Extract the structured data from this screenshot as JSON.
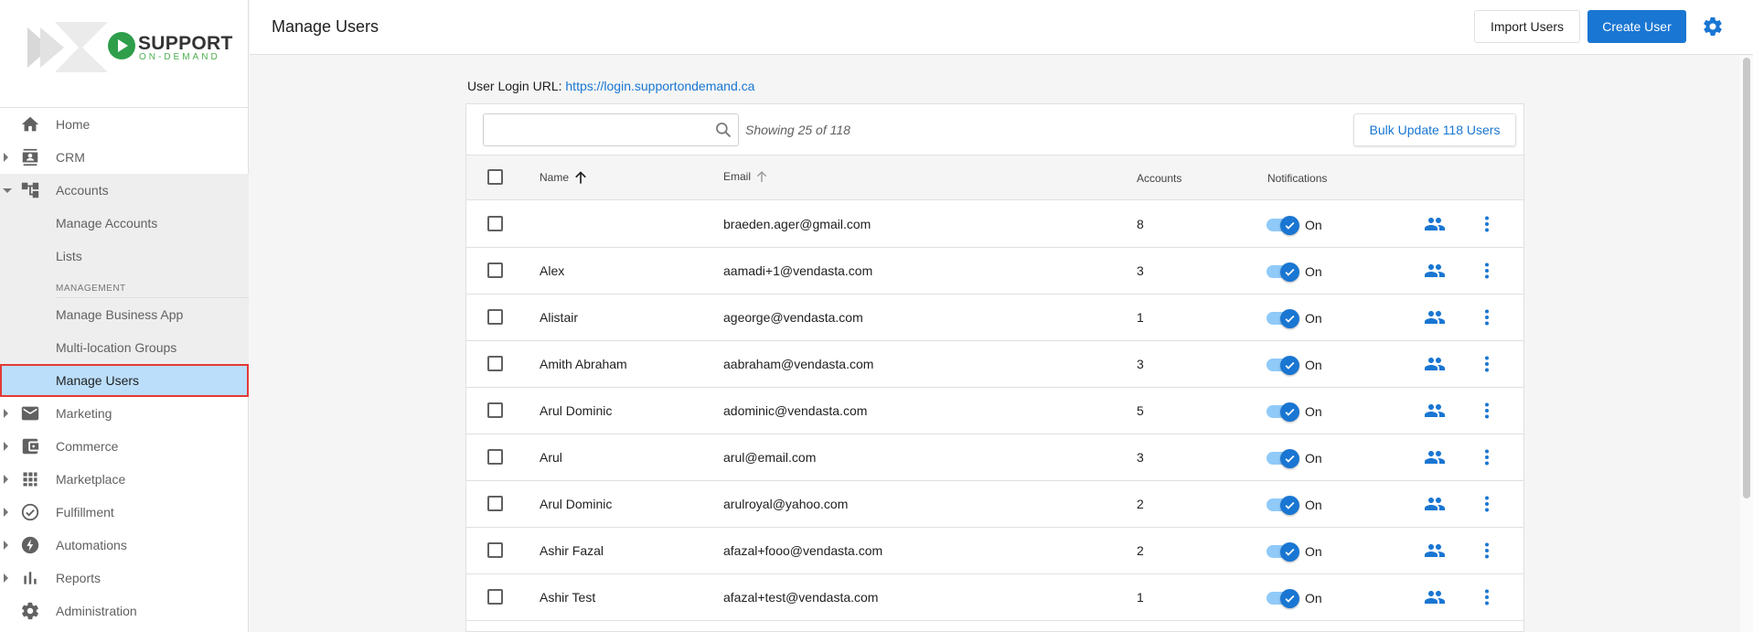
{
  "brand": {
    "line1": "SUPPORT",
    "line2": "ON-DEMAND"
  },
  "header": {
    "title": "Manage Users",
    "import_label": "Import Users",
    "create_label": "Create User"
  },
  "sidebar": {
    "home": "Home",
    "crm": "CRM",
    "accounts": "Accounts",
    "manage_accounts": "Manage Accounts",
    "lists": "Lists",
    "management_label": "MANAGEMENT",
    "manage_business_app": "Manage Business App",
    "multi_location_groups": "Multi-location Groups",
    "manage_users": "Manage Users",
    "marketing": "Marketing",
    "commerce": "Commerce",
    "marketplace": "Marketplace",
    "fulfillment": "Fulfillment",
    "automations": "Automations",
    "reports": "Reports",
    "administration": "Administration"
  },
  "login": {
    "label": "User Login URL:",
    "url": "https://login.supportondemand.ca"
  },
  "table": {
    "search_placeholder": "",
    "showing": "Showing 25 of 118",
    "bulk_label": "Bulk Update 118 Users",
    "columns": {
      "name": "Name",
      "email": "Email",
      "accounts": "Accounts",
      "notifications": "Notifications"
    },
    "rows": [
      {
        "name": "",
        "email": "braeden.ager@gmail.com",
        "accounts": "8",
        "notif": "On"
      },
      {
        "name": "Alex",
        "email": "aamadi+1@vendasta.com",
        "accounts": "3",
        "notif": "On"
      },
      {
        "name": "Alistair",
        "email": "ageorge@vendasta.com",
        "accounts": "1",
        "notif": "On"
      },
      {
        "name": "Amith Abraham",
        "email": "aabraham@vendasta.com",
        "accounts": "3",
        "notif": "On"
      },
      {
        "name": "Arul Dominic",
        "email": "adominic@vendasta.com",
        "accounts": "5",
        "notif": "On"
      },
      {
        "name": "Arul",
        "email": "arul@email.com",
        "accounts": "3",
        "notif": "On"
      },
      {
        "name": "Arul Dominic",
        "email": "arulroyal@yahoo.com",
        "accounts": "2",
        "notif": "On"
      },
      {
        "name": "Ashir Fazal",
        "email": "afazal+fooo@vendasta.com",
        "accounts": "2",
        "notif": "On"
      },
      {
        "name": "Ashir Test",
        "email": "afazal+test@vendasta.com",
        "accounts": "1",
        "notif": "On"
      }
    ]
  },
  "colors": {
    "accent": "#1976d2",
    "active_bg": "#bbdefb",
    "highlight_border": "#e53935"
  },
  "icons": [
    "home-icon",
    "crm-icon",
    "accounts-icon",
    "mail-icon",
    "wallet-icon",
    "grid-icon",
    "check-circle-icon",
    "bolt-icon",
    "bar-chart-icon",
    "gear-icon",
    "search-icon",
    "people-icon",
    "more-vert-icon",
    "sort-arrow-up-icon"
  ]
}
